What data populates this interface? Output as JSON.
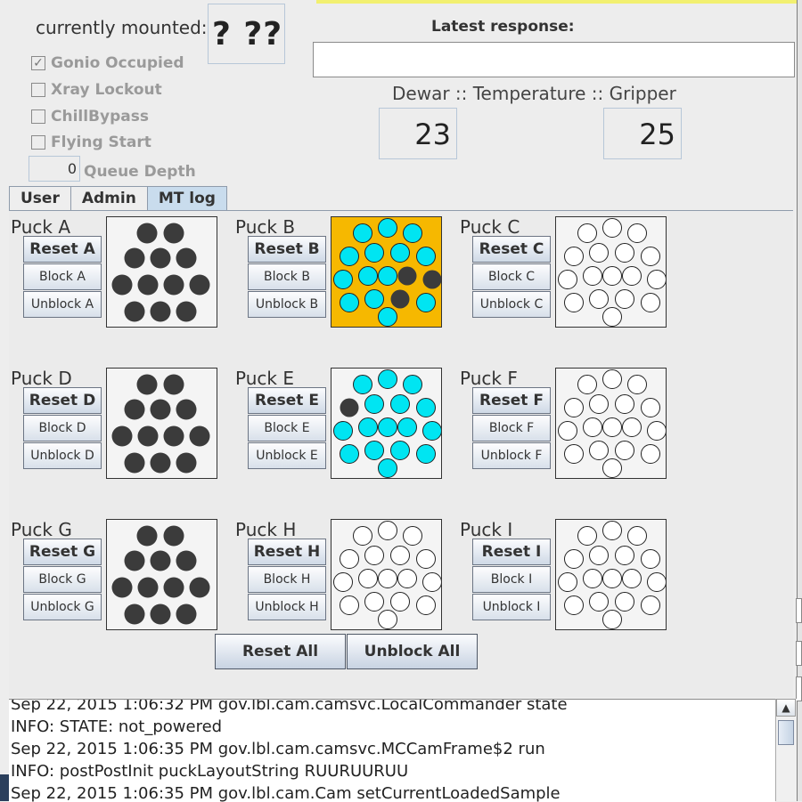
{
  "status": {
    "currently_mounted_label": "currently mounted:",
    "currently_mounted_value": "? ??",
    "latest_response_label": "Latest response:",
    "latest_response_value": "",
    "dtg_label": "Dewar :: Temperature :: Gripper",
    "temperature_value": "23",
    "gripper_value": "25"
  },
  "checkboxes": [
    {
      "label": "Gonio Occupied",
      "checked": true
    },
    {
      "label": "Xray Lockout",
      "checked": false
    },
    {
      "label": "ChillBypass",
      "checked": false
    },
    {
      "label": "Flying Start",
      "checked": false
    }
  ],
  "queue": {
    "value": "0",
    "label": "Queue Depth"
  },
  "tabs": [
    {
      "label": "User",
      "active": false
    },
    {
      "label": "Admin",
      "active": false
    },
    {
      "label": "MT log",
      "active": true
    }
  ],
  "pucks": [
    {
      "title": "Puck A",
      "reset": "Reset A",
      "block": "Block A",
      "unblock": "Unblock A",
      "layout": "dense",
      "highlight": false,
      "states": "DDDDDDDDDDD"
    },
    {
      "title": "Puck B",
      "reset": "Reset B",
      "block": "Block B",
      "unblock": "Unblock B",
      "layout": "ring",
      "highlight": true,
      "states": "CCCCCCCCCCDDCCDCC"
    },
    {
      "title": "Puck C",
      "reset": "Reset C",
      "block": "Block C",
      "unblock": "Unblock C",
      "layout": "ring",
      "highlight": false,
      "states": "EEEEEEEEEEEEEEEEE"
    },
    {
      "title": "Puck D",
      "reset": "Reset D",
      "block": "Block D",
      "unblock": "Unblock D",
      "layout": "dense",
      "highlight": false,
      "states": "DDDDDDDDDDD"
    },
    {
      "title": "Puck E",
      "reset": "Reset E",
      "block": "Block E",
      "unblock": "Unblock E",
      "layout": "ring",
      "highlight": false,
      "states": "CCCDCCCCCCCCCCCCC"
    },
    {
      "title": "Puck F",
      "reset": "Reset F",
      "block": "Block F",
      "unblock": "Unblock F",
      "layout": "ring",
      "highlight": false,
      "states": "EEEEEEEEEEEEEEEEE"
    },
    {
      "title": "Puck G",
      "reset": "Reset G",
      "block": "Block G",
      "unblock": "Unblock G",
      "layout": "dense",
      "highlight": false,
      "states": "DDDDDDDDDDD"
    },
    {
      "title": "Puck H",
      "reset": "Reset H",
      "block": "Block H",
      "unblock": "Unblock H",
      "layout": "ring",
      "highlight": false,
      "states": "EEEEEEEEEEEEEEEEE"
    },
    {
      "title": "Puck I",
      "reset": "Reset I",
      "block": "Block I",
      "unblock": "Unblock I",
      "layout": "ring",
      "highlight": false,
      "states": "EEEEEEEEEEEEEEEEE"
    }
  ],
  "actions": {
    "reset_all": "Reset All",
    "unblock_all": "Unblock All"
  },
  "log": [
    "Sep 22, 2015 1:06:32 PM gov.lbl.cam.camsvc.LocalCommander state",
    "INFO: STATE: not_powered",
    "Sep 22, 2015 1:06:35 PM gov.lbl.cam.camsvc.MCCamFrame$2 run",
    "INFO: postPostInit puckLayoutString RUURUURUU",
    "Sep 22, 2015 1:06:35 PM gov.lbl.cam.Cam setCurrentLoadedSample"
  ],
  "colors": {
    "occupied": "#3b3b3b",
    "cyan": "#00e5f2",
    "empty": "#ffffff",
    "highlight_bg": "#f6b800",
    "tab_active": "#c9dced"
  },
  "icons": {
    "check": "check-icon",
    "scroll_up": "arrow-up-icon"
  }
}
